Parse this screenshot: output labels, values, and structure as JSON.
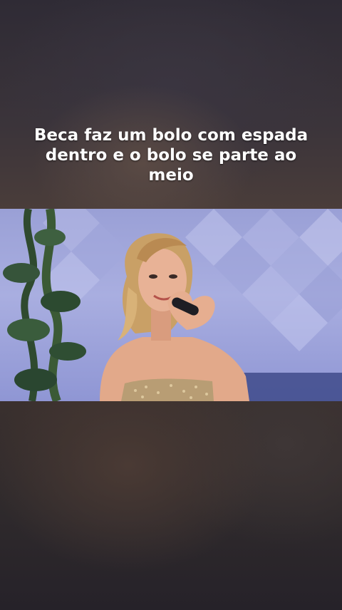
{
  "caption": {
    "text": "Beca faz um bolo com espada dentro e o bolo se parte ao meio"
  },
  "video": {
    "scene": "woman-singing-heart-hands"
  },
  "colors": {
    "caption_text": "#ffffff",
    "backdrop_purple": "#a9aee0",
    "dress_gold": "#b89d74"
  }
}
